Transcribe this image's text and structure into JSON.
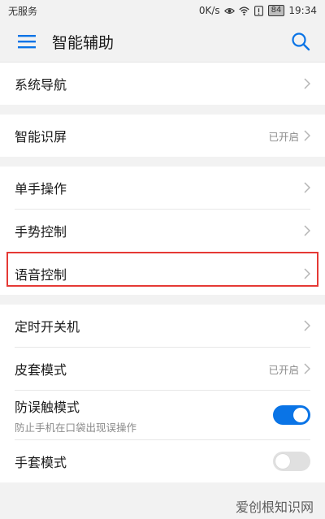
{
  "status": {
    "carrier": "无服务",
    "speed": "0K/s",
    "battery": "84",
    "time": "19:34"
  },
  "appbar": {
    "title": "智能辅助"
  },
  "items": {
    "nav": {
      "label": "系统导航"
    },
    "smart_screen": {
      "label": "智能识屏",
      "value": "已开启"
    },
    "one_hand": {
      "label": "单手操作"
    },
    "gesture": {
      "label": "手势控制"
    },
    "voice": {
      "label": "语音控制"
    },
    "timer_power": {
      "label": "定时开关机"
    },
    "cover_mode": {
      "label": "皮套模式",
      "value": "已开启"
    },
    "anti_touch": {
      "label": "防误触模式",
      "sub": "防止手机在口袋出现误操作",
      "toggle": "on"
    },
    "glove_mode": {
      "label": "手套模式",
      "toggle": "off"
    }
  },
  "watermark": "爱创根知识网",
  "colors": {
    "accent": "#0a74e6",
    "highlight": "#e53935"
  }
}
